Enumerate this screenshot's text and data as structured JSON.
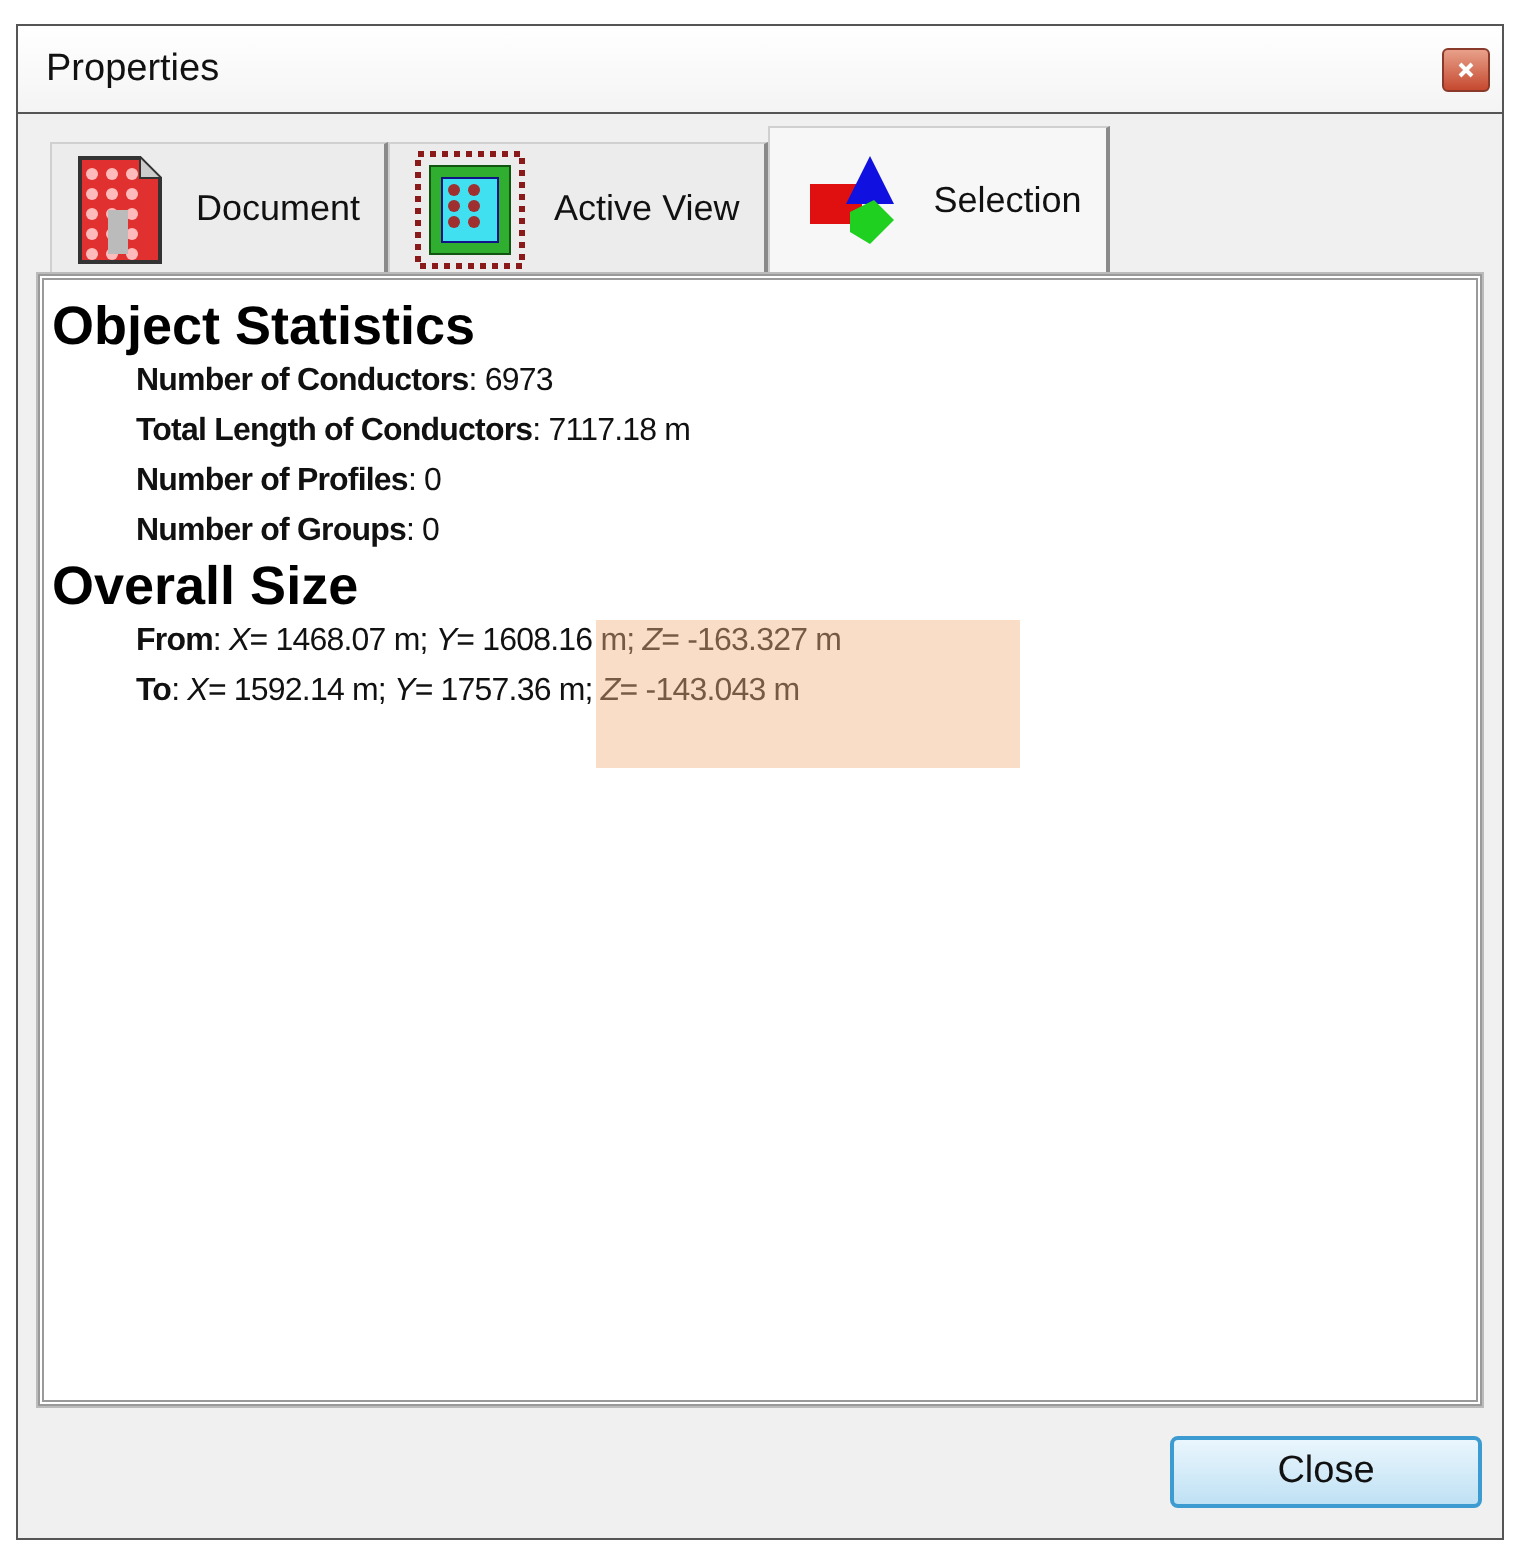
{
  "window": {
    "title": "Properties"
  },
  "tabs": [
    {
      "label": "Document",
      "kind": "document",
      "selected": false
    },
    {
      "label": "Active View",
      "kind": "view",
      "selected": false
    },
    {
      "label": "Selection",
      "kind": "selection",
      "selected": true
    }
  ],
  "sections": [
    {
      "heading": "Object Statistics",
      "lines": [
        "**Number of Conductors**: 6973",
        "**Total Length of Conductors**: 7117.18 m",
        "**Number of Profiles**: 0",
        "**Number of Groups**: 0"
      ]
    },
    {
      "heading": "Overall Size",
      "lines": [
        "**From**: *X*= 1468.07 m; *Y*= 1608.16 m; *Z*= -163.327 m",
        "**To**: *X*= 1592.14 m; *Y*= 1757.36 m; *Z*= -143.043 m"
      ]
    }
  ],
  "buttons": [
    "Close"
  ]
}
